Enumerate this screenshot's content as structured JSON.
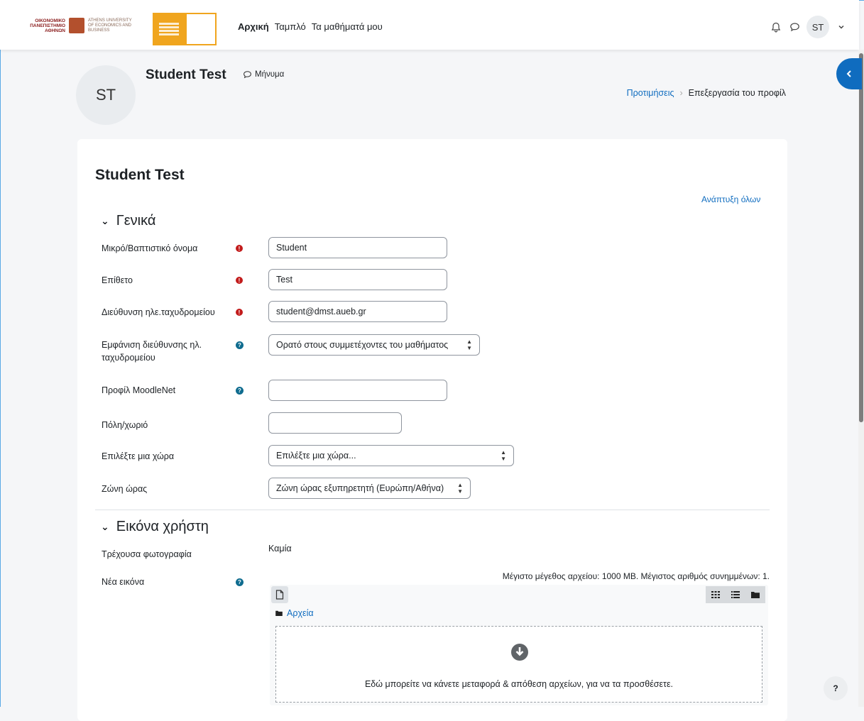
{
  "navbar": {
    "logo_uni_gr": "ΟΙΚΟΝΟΜΙΚΟ ΠΑΝΕΠΙΣΤΗΜΙΟ ΑΘΗΝΩΝ",
    "logo_uni_en": "ATHENS UNIVERSITY OF ECONOMICS AND BUSINESS",
    "links": [
      {
        "label": "Αρχική",
        "active": true
      },
      {
        "label": "Ταμπλό",
        "active": false
      },
      {
        "label": "Τα μαθήματά μου",
        "active": false
      }
    ],
    "user_initials": "ST",
    "notifications_icon": "bell-icon",
    "messages_icon": "chat-icon"
  },
  "header": {
    "user_name": "Student Test",
    "avatar_initials": "ST",
    "message_label": "Μήνυμα",
    "breadcrumb": [
      "Προτιμήσεις",
      "Επεξεργασία του προφίλ"
    ]
  },
  "form": {
    "title": "Student Test",
    "expand_all": "Ανάπτυξη όλων",
    "general": {
      "heading": "Γενικά",
      "fields": {
        "firstname": {
          "label": "Μικρό/Βαπτιστικό όνομα",
          "value": "Student"
        },
        "lastname": {
          "label": "Επίθετο",
          "value": "Test"
        },
        "email": {
          "label": "Διεύθυνση ηλε.ταχυδρομείου",
          "value": "student@dmst.aueb.gr"
        },
        "email_display": {
          "label": "Εμφάνιση διεύθυνσης ηλ. ταχυδρομείου",
          "value": "Ορατό στους συμμετέχοντες του μαθήματος"
        },
        "moodlenet": {
          "label": "Προφίλ MoodleNet",
          "value": ""
        },
        "city": {
          "label": "Πόλη/χωριό",
          "value": ""
        },
        "country": {
          "label": "Επιλέξτε μια χώρα",
          "value": "Επιλέξτε μια χώρα..."
        },
        "timezone": {
          "label": "Ζώνη ώρας",
          "value": "Ζώνη ώρας εξυπηρετητή (Ευρώπη/Αθήνα)"
        }
      }
    },
    "picture": {
      "heading": "Εικόνα χρήστη",
      "current_label": "Τρέχουσα φωτογραφία",
      "current_value": "Καμία",
      "new_label": "Νέα εικόνα",
      "limits": "Μέγιστο μέγεθος αρχείου: 1000 MB. Μέγιστος αριθμός συνημμένων: 1.",
      "folder_label": "Αρχεία",
      "dropzone_text": "Εδώ μπορείτε να κάνετε μεταφορά & απόθεση αρχείων, για να τα προσθέσετε."
    }
  },
  "help_button": "?",
  "colors": {
    "accent": "#0f6cbf",
    "required": "#c21b1b",
    "help": "#0f6c8f"
  }
}
